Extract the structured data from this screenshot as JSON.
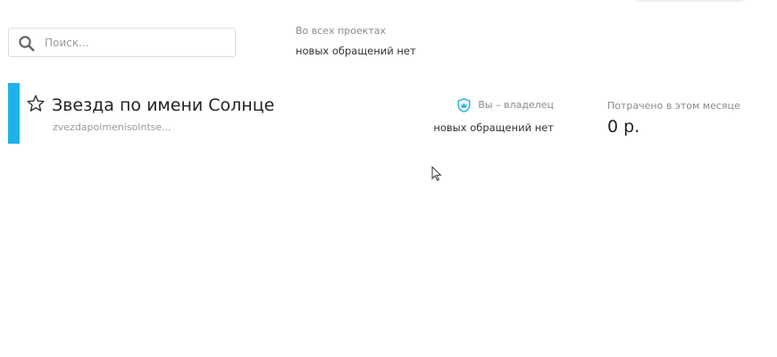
{
  "search": {
    "placeholder": "Поиск..."
  },
  "all_projects": {
    "label": "Во всех проектах",
    "status": "новых обращений нет"
  },
  "project": {
    "title": "Звезда по имени Солнце",
    "slug": "zvezdapoimenisolntse...",
    "role": "Вы – владелец",
    "status": "новых обращений нет",
    "spent_label": "Потрачено в этом месяце",
    "spent_value": "0 р."
  },
  "colors": {
    "accent": "#1fb2ea",
    "muted_text": "#8a8a8a",
    "dark_text": "#222222"
  },
  "icons": {
    "search": "search-icon",
    "favorite": "star-outline-icon",
    "owner": "shield-crown-icon",
    "pointer": "mouse-cursor-icon"
  }
}
